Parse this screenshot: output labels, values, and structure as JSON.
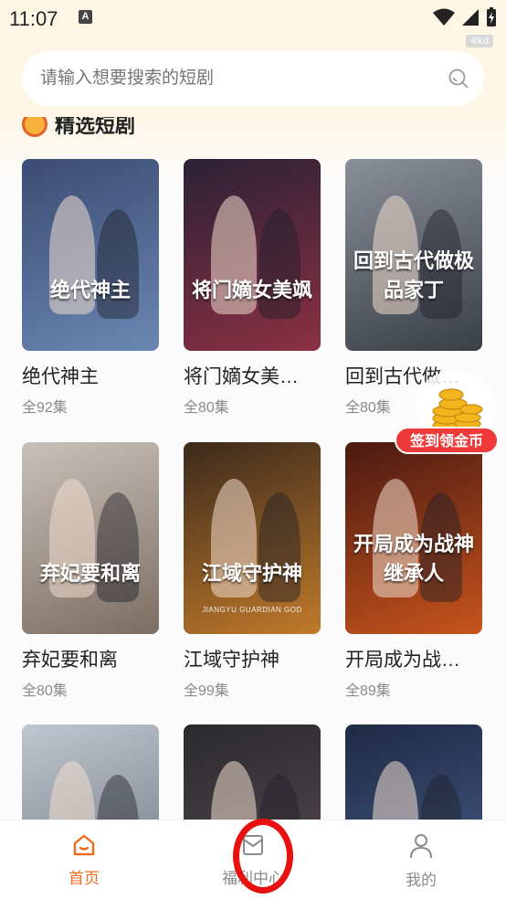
{
  "status": {
    "time": "11:07",
    "badge": "A",
    "tag": "4lkd"
  },
  "search": {
    "placeholder": "请输入想要搜索的短剧"
  },
  "section": {
    "title": "精选短剧"
  },
  "dramas": [
    {
      "title": "绝代神主",
      "episodes": "全92集",
      "poster_text": "绝代神主",
      "poster_sub": "",
      "colors": [
        "#3b4c73",
        "#6a87b3"
      ]
    },
    {
      "title": "将门嫡女美…",
      "episodes": "全80集",
      "poster_text": "将门嫡女美飒",
      "poster_sub": "",
      "colors": [
        "#2b2135",
        "#8c3043"
      ]
    },
    {
      "title": "回到古代做…",
      "episodes": "全80集",
      "poster_text": "回到古代做极品家丁",
      "poster_sub": "",
      "colors": [
        "#8a8f9a",
        "#3a3e45"
      ]
    },
    {
      "title": "弃妃要和离",
      "episodes": "全80集",
      "poster_text": "弃妃要和离",
      "poster_sub": "",
      "colors": [
        "#c9c1b9",
        "#7c6d62"
      ]
    },
    {
      "title": "江域守护神",
      "episodes": "全99集",
      "poster_text": "江域守护神",
      "poster_sub": "JIANGYU GUARDIAN GOD",
      "colors": [
        "#3c2a1c",
        "#c07a2a"
      ]
    },
    {
      "title": "开局成为战…",
      "episodes": "全89集",
      "poster_text": "开局成为战神继承人",
      "poster_sub": "",
      "colors": [
        "#4a1a12",
        "#c7541c"
      ]
    },
    {
      "title": "",
      "episodes": "",
      "poster_text": "",
      "poster_sub": "",
      "colors": [
        "#bfc6cf",
        "#6d7480"
      ]
    },
    {
      "title": "",
      "episodes": "",
      "poster_text": "",
      "poster_sub": "",
      "colors": [
        "#2a2a2e",
        "#5a4e54"
      ]
    },
    {
      "title": "",
      "episodes": "",
      "poster_text": "",
      "poster_sub": "",
      "colors": [
        "#1f2a45",
        "#49608a"
      ]
    }
  ],
  "floating": {
    "checkin_label": "签到领金币"
  },
  "tabs": [
    {
      "label": "首页",
      "icon": "home-icon",
      "active": true
    },
    {
      "label": "福利中心",
      "icon": "welfare-icon",
      "active": false
    },
    {
      "label": "我的",
      "icon": "profile-icon",
      "active": false
    }
  ],
  "colors": {
    "accent": "#f26b1d",
    "tab_inactive": "#8a8a8a",
    "highlight": "#e8110f"
  }
}
